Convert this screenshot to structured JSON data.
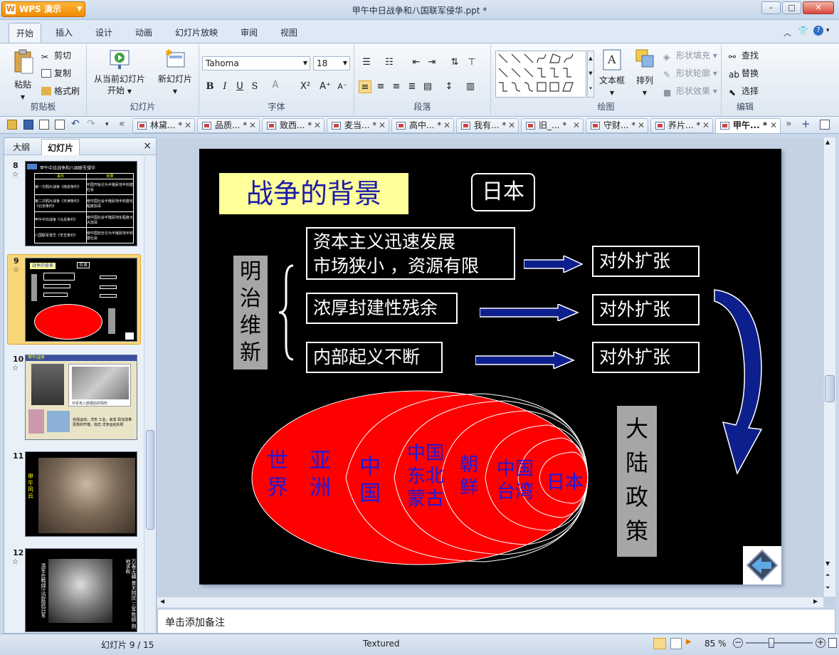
{
  "app": {
    "name": "WPS 演示",
    "doc_title": "甲午中日战争和八国联军侵华.ppt *"
  },
  "window": {
    "minimize": "–",
    "maximize": "□",
    "close": "✕"
  },
  "ribbon_tabs": [
    "开始",
    "插入",
    "设计",
    "动画",
    "幻灯片放映",
    "审阅",
    "视图"
  ],
  "clipboard": {
    "paste": "粘贴",
    "cut": "剪切",
    "copy": "复制",
    "format_painter": "格式刷",
    "group": "剪贴板"
  },
  "slides_group": {
    "from_current": "从当前幻灯片",
    "start": "开始",
    "new_slide": "新幻灯片",
    "group": "幻灯片"
  },
  "font_group": {
    "font_name": "Tahoma",
    "font_size": "18",
    "group": "字体"
  },
  "paragraph_group": {
    "group": "段落"
  },
  "drawing_group": {
    "textbox": "文本框",
    "arrange": "排列",
    "shape_fill": "形状填充",
    "shape_outline": "形状轮廓",
    "shape_effect": "形状效果",
    "group": "绘图"
  },
  "edit_group": {
    "find": "查找",
    "replace": "替换",
    "select": "选择",
    "group": "编辑"
  },
  "doc_tabs": [
    "林黛... *",
    "品质... *",
    "致西... *",
    "麦当... *",
    "高中... *",
    "我有... *",
    "旧_... *",
    "守财... *",
    "荞片... *",
    "甲午... *"
  ],
  "left_panel": {
    "tabs": [
      "大纲",
      "幻灯片"
    ],
    "close": "×"
  },
  "thumbnails": [
    {
      "num": "8",
      "title": "甲午中日战争和八国联军侵华",
      "cols": [
        "事件",
        "结果"
      ],
      "rows": [
        [
          "第一次鸦片战争《南京条约》",
          "中国开始沦为半殖民地半封建社会"
        ],
        [
          "第二次鸦片战争《天津条约》《北京条约》",
          "使中国社会半殖民地半封建化程度加深"
        ],
        [
          "甲午中日战争《马关条约》",
          "使中国社会半殖民地化程度大大加深"
        ],
        [
          "八国联军侵华《辛丑条约》",
          "使中国完全沦为半殖民地半封建社会"
        ]
      ]
    },
    {
      "num": "9",
      "title": "战争的背景",
      "right": "日本"
    },
    {
      "num": "10",
      "title": "甲午战争",
      "caption": "日军攻入旅顺后的情形",
      "text": "自强运动，洋务 工业，启发 政治改革思想的开端，标志 洋务运动失败"
    },
    {
      "num": "11",
      "vertical": "甲午风云"
    },
    {
      "num": "12",
      "left_text": "清军在鸭绿江边抵抗日军",
      "right_text": "万寿无疆 普天同庆 三军败绩 割地求和"
    }
  ],
  "slide": {
    "title": "战争的背景",
    "japan": "日本",
    "meiji": "明治维新",
    "cause1_line1": "资本主义迅速发展",
    "cause1_line2": "市场狭小 ，资源有限",
    "cause2": "浓厚封建性残余",
    "cause3": "内部起义不断",
    "expand1": "对外扩张",
    "expand2": "对外扩张",
    "expand3": "对外扩张",
    "policy": "大陆政策",
    "ellipses": [
      "世界",
      "亚洲",
      "中国",
      "中国东北蒙古",
      "朝鲜",
      "中国台湾",
      "日本"
    ]
  },
  "notes": {
    "placeholder": "单击添加备注"
  },
  "status": {
    "slide_indicator": "幻灯片 9 / 15",
    "theme": "Textured",
    "zoom": "85 %"
  }
}
